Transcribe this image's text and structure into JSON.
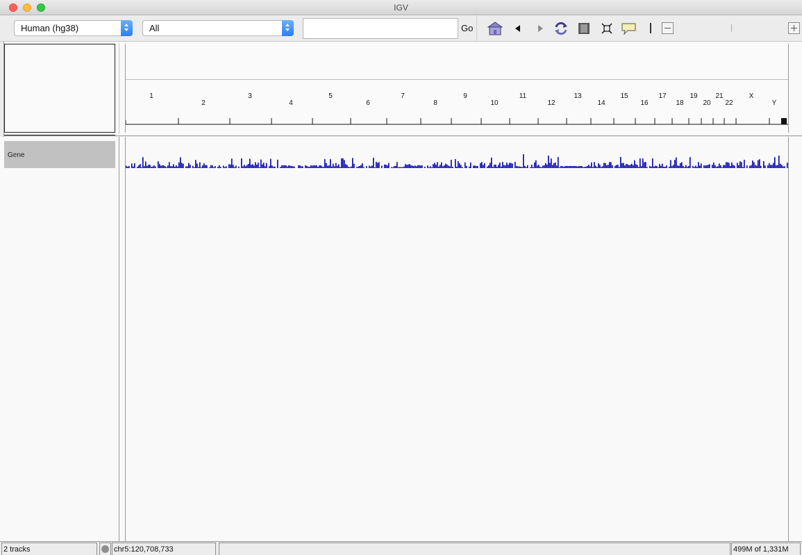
{
  "window": {
    "title": "IGV"
  },
  "toolbar": {
    "genome_selected": "Human (hg38)",
    "chromosome_selected": "All",
    "locus_value": "",
    "go_label": "Go",
    "icons": [
      "home-icon",
      "back-arrow-icon",
      "forward-arrow-icon",
      "refresh-icon",
      "region-of-interest-icon",
      "resize-to-window-icon",
      "popup-info-icon",
      "ruler-divider-icon",
      "zoom-out-icon",
      "zoom-in-icon"
    ]
  },
  "ruler": {
    "chromosomes_upper": [
      "1",
      "3",
      "5",
      "7",
      "9",
      "11",
      "13",
      "15",
      "17",
      "19",
      "21",
      "X"
    ],
    "chromosomes_lower": [
      "2",
      "4",
      "6",
      "8",
      "10",
      "12",
      "14",
      "16",
      "18",
      "20",
      "22",
      "Y"
    ]
  },
  "tracks": {
    "gene_track_name": "Gene",
    "gene_color": "#0000b2"
  },
  "status": {
    "track_count": "2 tracks",
    "locus": "chr5:120,708,733",
    "message": "",
    "memory": "499M of 1,331M"
  }
}
